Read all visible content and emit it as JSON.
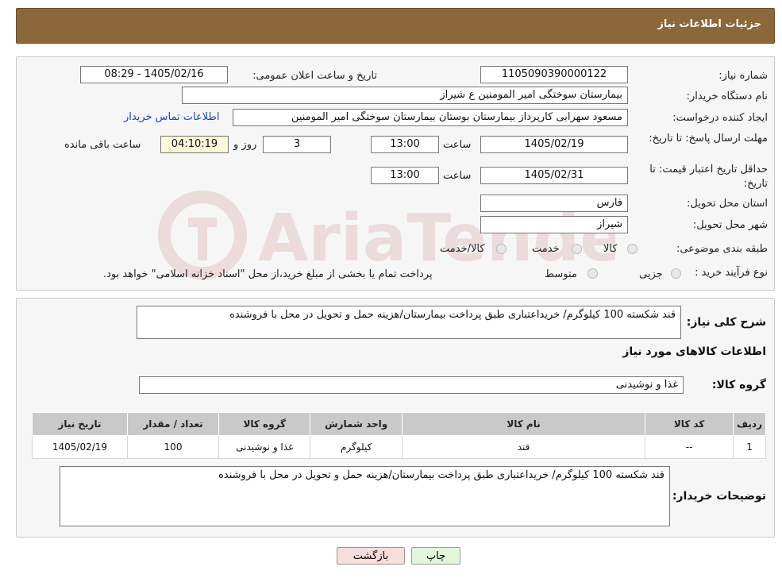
{
  "header": {
    "title": "جزئیات اطلاعات نیاز"
  },
  "fields": {
    "need_number_label": "شماره نیاز:",
    "need_number": "1105090390000122",
    "announce_label": "تاریخ و ساعت اعلان عمومی:",
    "announce_value": "1405/02/16 - 08:29",
    "buyer_org_label": "نام دستگاه خریدار:",
    "buyer_org": "بیمارستان سوختگی امیر المومنین  ع  شیراز",
    "creator_label": "ایجاد کننده درخواست:",
    "creator": "مسعود سهرابی کارپرداز بیمارستان بوستان بیمارستان سوختگی امیر المومنین",
    "contact_link": "اطلاعات تماس خریدار",
    "reply_deadline_label": "مهلت ارسال پاسخ: تا تاریخ:",
    "reply_date": "1405/02/19",
    "time_label": "ساعت",
    "reply_time": "13:00",
    "days": "3",
    "days_label": "روز و",
    "remaining": "04:10:19",
    "remaining_label": "ساعت باقی مانده",
    "price_validity_label": "حداقل تاریخ اعتبار قیمت: تا تاریخ:",
    "price_date": "1405/02/31",
    "price_time": "13:00",
    "province_label": "استان محل تحویل:",
    "province": "فارس",
    "city_label": "شهر محل تحویل:",
    "city": "شیراز",
    "category_label": "طبقه بندی موضوعی:",
    "category_options": [
      "کالا",
      "خدمت",
      "کالا/خدمت"
    ],
    "purchase_type_label": "نوع فرآیند خرید :",
    "purchase_options": [
      "جزیی",
      "متوسط"
    ],
    "purchase_note": "پرداخت تمام یا بخشی از مبلغ خرید،از محل \"اسناد خزانه اسلامی\" خواهد بود."
  },
  "summary": {
    "label": "شرح کلی نیاز:",
    "text": "قند شکسته 100 کیلوگرم/ خریداعتباری طبق پرداخت بیمارستان/هزینه حمل و تحویل در محل با فروشنده",
    "goods_info_title": "اطلاعات کالاهای مورد نیاز",
    "goods_group_label": "گروه کالا:",
    "goods_group": "غذا و نوشیدنی"
  },
  "table": {
    "headers": [
      "ردیف",
      "کد کالا",
      "نام کالا",
      "واحد شمارش",
      "گروه کالا",
      "تعداد / مقدار",
      "تاریخ نیاز"
    ],
    "rows": [
      [
        "1",
        "--",
        "قند",
        "کیلوگرم",
        "غذا و نوشیدنی",
        "100",
        "1405/02/19"
      ]
    ]
  },
  "buyer_notes": {
    "label": "توضیحات خریدار:",
    "text": "قند شکسته 100 کیلوگرم/ خریداعتباری طبق پرداخت بیمارستان/هزینه حمل و تحویل در محل با فروشنده"
  },
  "buttons": {
    "print": "چاپ",
    "back": "بازگشت"
  },
  "colors": {
    "title_bg": "#8c6739",
    "back_btn_bg": "#f9dcdc",
    "print_btn_bg": "#e2f7da",
    "link": "#1a3fd0"
  },
  "watermark": {
    "text": "AriaTender.neT",
    "icon": "watermark-logo-icon"
  }
}
